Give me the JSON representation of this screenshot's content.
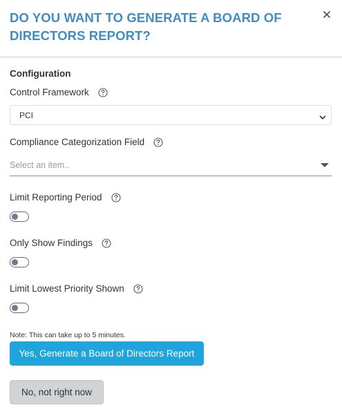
{
  "dialog": {
    "title": "DO YOU WANT TO GENERATE A BOARD OF DIRECTORS REPORT?",
    "close_icon": "close-icon"
  },
  "configuration": {
    "section_title": "Configuration",
    "control_framework": {
      "label": "Control Framework",
      "value": "PCI",
      "help_icon": "question-circle-icon"
    },
    "compliance_field": {
      "label": "Compliance Categorization Field",
      "placeholder": "Select an item..",
      "help_icon": "question-circle-icon"
    },
    "toggles": [
      {
        "label": "Limit Reporting Period",
        "on": false
      },
      {
        "label": "Only Show Findings",
        "on": false
      },
      {
        "label": "Limit Lowest Priority Shown",
        "on": false
      }
    ]
  },
  "note": "Note: This can take up to 5 minutes.",
  "buttons": {
    "confirm": "Yes, Generate a Board of Directors Report",
    "cancel": "No, not right now"
  },
  "colors": {
    "title": "#3f8dc1",
    "primary_button": "#1fa5dc",
    "secondary_button": "#d1d3d6"
  }
}
